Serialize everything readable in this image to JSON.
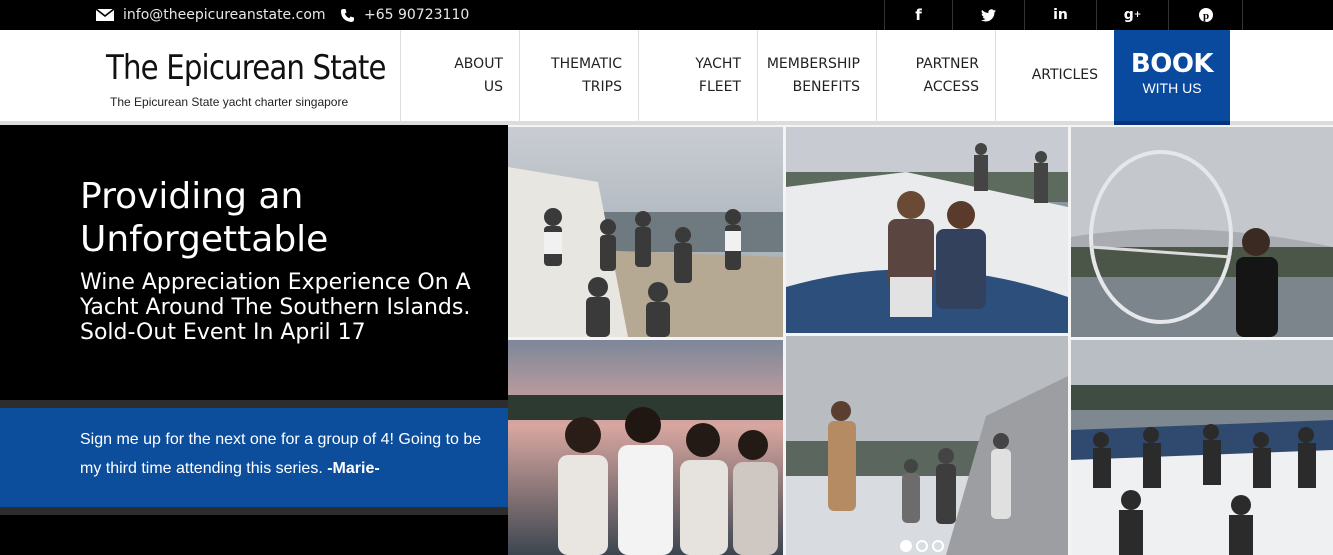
{
  "topbar": {
    "email": "info@theepicureanstate.com",
    "phone": "+65 90723110",
    "social": [
      {
        "icon": "facebook-icon",
        "glyph": "f"
      },
      {
        "icon": "twitter-icon",
        "glyph": "t"
      },
      {
        "icon": "linkedin-icon",
        "glyph": "in"
      },
      {
        "icon": "google-plus-icon",
        "glyph": "g+"
      },
      {
        "icon": "pinterest-icon",
        "glyph": "p"
      }
    ]
  },
  "header": {
    "logo_title": "The Epicurean State",
    "logo_subtitle": "The Epicurean State yacht charter singapore",
    "nav": {
      "about": [
        "ABOUT",
        "US"
      ],
      "thematic": [
        "THEMATIC",
        "TRIPS"
      ],
      "yacht": [
        "YACHT",
        "FLEET"
      ],
      "membership": [
        "MEMBERSHIP",
        "BENEFITS"
      ],
      "partner": [
        "PARTNER",
        "ACCESS"
      ],
      "articles": "ARTICLES"
    },
    "book": {
      "big": "BOOK",
      "small": "WITH US"
    }
  },
  "hero": {
    "title": "Providing an Unforgettable",
    "subtitle": "Wine Appreciation Experience On A Yacht Around The Southern Islands. Sold-Out Event In April 17",
    "quote": "Sign me up for the next one for a group of 4! Going to be my third time attending this series.",
    "quote_author": "-Marie-"
  },
  "slider": {
    "dots": 3,
    "active_index": 0
  },
  "colors": {
    "brand_blue": "#0c4d9c",
    "book_blue": "#0a4a9e",
    "black": "#000000",
    "white": "#ffffff"
  }
}
